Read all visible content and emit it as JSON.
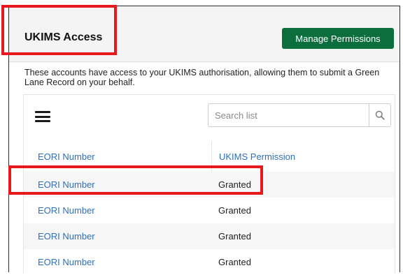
{
  "card": {
    "title": "UKIMS Access",
    "manage_button_label": "Manage Permissions",
    "description": "These accounts have access to your UKIMS authorisation, allowing them to submit a Green Lane Record on your behalf."
  },
  "list": {
    "search_placeholder": "Search list",
    "columns": [
      "EORI Number",
      "UKIMS Permission"
    ],
    "rows": [
      {
        "eori": "EORI Number",
        "permission": "Granted"
      },
      {
        "eori": "EORI Number",
        "permission": "Granted"
      },
      {
        "eori": "EORI Number",
        "permission": "Granted"
      },
      {
        "eori": "EORI Number",
        "permission": "Granted"
      }
    ]
  },
  "icons": {
    "menu": "hamburger-menu-icon",
    "search": "search-icon"
  },
  "colors": {
    "primary_button": "#0c6e3d",
    "link": "#2f6fb6",
    "highlight": "#e8191c"
  }
}
